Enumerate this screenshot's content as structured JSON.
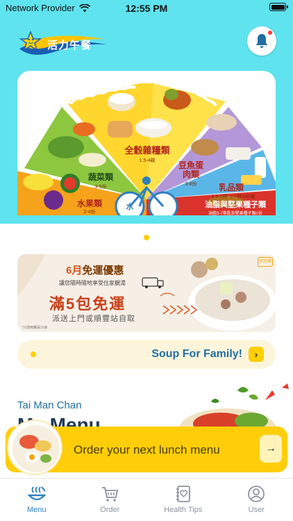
{
  "status_bar": {
    "carrier": "Network Provider",
    "time": "12:55 PM"
  },
  "header": {
    "logo_text": "活力午餐"
  },
  "pyramid": {
    "categories": [
      {
        "name": "全穀雜糧類",
        "portion": "1.5-4碗"
      },
      {
        "name": "蔬菜類",
        "portion": "3-5份"
      },
      {
        "name": "水果類",
        "portion": "2-4份"
      },
      {
        "name": "豆魚蛋肉類",
        "portion": "3-8份"
      },
      {
        "name": "乳品類",
        "portion": "1.5-2杯（一杯240毫升）"
      },
      {
        "name": "油脂與堅果種子類",
        "portion": "油脂3-7茶匙及堅果種子類1份"
      }
    ],
    "center_badge": "水"
  },
  "promo": {
    "title_month": "6月",
    "title_rest": "免運優惠",
    "subtitle": "讓您隨時隨地享受住家靚湯",
    "headline": "滿5包免運",
    "detail": "派送上門或順豐站自取",
    "footnote": "*只適用購買冷凍",
    "tag": "好打滾"
  },
  "soup_bar": {
    "label": "Soup For Family!"
  },
  "user_section": {
    "name": "Tai Man Chan",
    "heading": "My Menu"
  },
  "order_bar": {
    "label": "Order your next lunch menu"
  },
  "tabs": [
    {
      "label": "Menu",
      "icon": "menu-bowl-icon",
      "active": true
    },
    {
      "label": "Order",
      "icon": "cart-icon",
      "active": false
    },
    {
      "label": "Health Tips",
      "icon": "health-book-icon",
      "active": false
    },
    {
      "label": "User",
      "icon": "user-icon",
      "active": false
    }
  ],
  "colors": {
    "accent_yellow": "#ffce08",
    "brand_cyan": "#5fe3ee",
    "link_blue": "#1f6fa0",
    "tab_active": "#2c7fbf"
  }
}
